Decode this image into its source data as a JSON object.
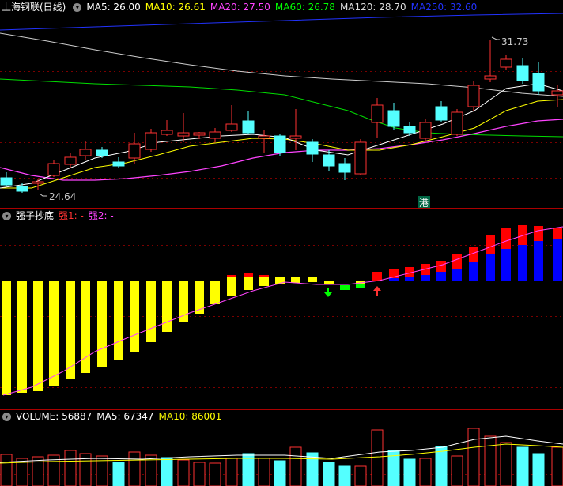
{
  "panels": {
    "price": {
      "stock_name": "上海钢联(日线)",
      "ma": [
        {
          "label": "MA5: 26.00",
          "color": "#ffffff"
        },
        {
          "label": "MA10: 26.61",
          "color": "#ffff00"
        },
        {
          "label": "MA20: 27.50",
          "color": "#ff44ff"
        },
        {
          "label": "MA60: 26.78",
          "color": "#00ff00"
        },
        {
          "label": "MA120: 28.70",
          "color": "#dddddd"
        },
        {
          "label": "MA250: 32.60",
          "color": "#2233ff"
        }
      ],
      "high_label": "31.73",
      "low_label": "24.64",
      "hk_badge": "港"
    },
    "indicator": {
      "name": "强子抄底",
      "line1": "强1: -",
      "line2": "强2: -"
    },
    "volume": {
      "label": "VOLUME: 56887",
      "ma5": "MA5: 67347",
      "ma10": "MA10: 86001"
    }
  },
  "colors": {
    "up": "#ff3232",
    "down": "#54ffff",
    "ma5": "#ffffff",
    "ma10": "#ffff00",
    "ma20": "#ff44ff",
    "ma60": "#00ff00",
    "ma120": "#dddddd",
    "ma250": "#2233ff",
    "bar_yellow": "#ffff00",
    "bar_red": "#ff0000",
    "bar_blue": "#0000ff",
    "arrow_green": "#00ff00",
    "arrow_red": "#ff0000"
  },
  "icons": [
    "dropdown-circle-icon",
    "arrow-down-icon",
    "arrow-up-icon"
  ]
}
